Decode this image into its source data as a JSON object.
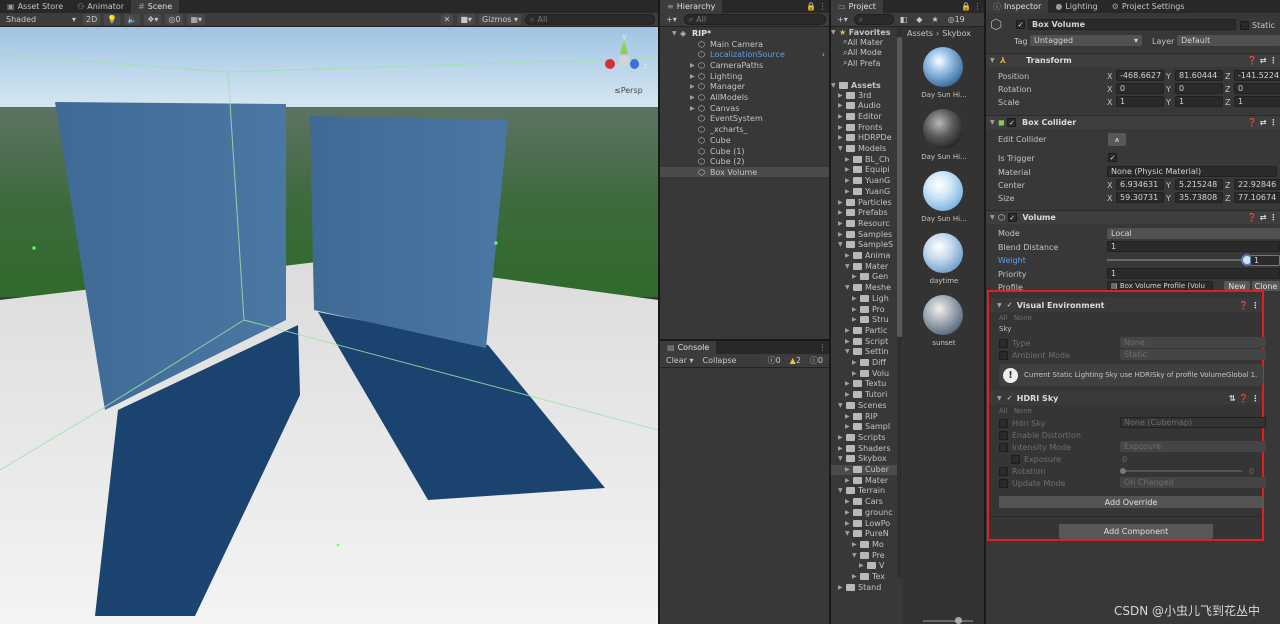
{
  "scene": {
    "tabs": [
      "Asset Store",
      "Animator",
      "Scene"
    ],
    "shading": "Shaded",
    "btn2d": "2D",
    "fx_count": "0",
    "gizmos": "Gizmos",
    "search_placeholder": "All",
    "persp": "Persp",
    "gizmo_axes": {
      "y": "y",
      "z": "z",
      "x": "x"
    }
  },
  "hierarchy": {
    "tab": "Hierarchy",
    "search_placeholder": "All",
    "root": "RIP*",
    "items": [
      {
        "label": "Main Camera",
        "arrow": "",
        "highlight": false
      },
      {
        "label": "LocalizationSource",
        "arrow": "",
        "highlight": true
      },
      {
        "label": "CameraPaths",
        "arrow": "▶",
        "highlight": false
      },
      {
        "label": "Lighting",
        "arrow": "▶",
        "highlight": false
      },
      {
        "label": "Manager",
        "arrow": "▶",
        "highlight": false
      },
      {
        "label": "AllModels",
        "arrow": "▶",
        "highlight": false
      },
      {
        "label": "Canvas",
        "arrow": "▶",
        "highlight": false
      },
      {
        "label": "EventSystem",
        "arrow": "",
        "highlight": false
      },
      {
        "label": "_xcharts_",
        "arrow": "",
        "highlight": false
      },
      {
        "label": "Cube",
        "arrow": "",
        "highlight": false
      },
      {
        "label": "Cube (1)",
        "arrow": "",
        "highlight": false
      },
      {
        "label": "Cube (2)",
        "arrow": "",
        "highlight": false
      },
      {
        "label": "Box Volume",
        "arrow": "",
        "highlight": false
      }
    ],
    "selected": "Box Volume"
  },
  "console": {
    "tab": "Console",
    "clear": "Clear",
    "collapse": "Collapse",
    "info": "0",
    "warn": "2",
    "err": "0"
  },
  "project": {
    "tab": "Project",
    "count": "19",
    "breadcrumb": [
      "Assets",
      "Skybox"
    ],
    "favorites": "Favorites",
    "fav_items": [
      "All Mater",
      "All Mode",
      "All Prefa"
    ],
    "assets": "Assets",
    "tree": [
      "3rd",
      "Audio",
      "Editor",
      "Fronts",
      "HDRPDe",
      "Models",
      "BL_Ch",
      "Equipi",
      "YuanG",
      "YuanG",
      "Particles",
      "Prefabs",
      "Resourc",
      "Samples",
      "SampleS",
      "Anima",
      "Mater",
      "Gen",
      "Meshe",
      "Ligh",
      "Pro",
      "Stru",
      "Partic",
      "Script",
      "Settin",
      "Diff",
      "Volu",
      "Textu",
      "Tutori",
      "Scenes",
      "RIP",
      "Sampl",
      "Scripts",
      "Shaders",
      "Skybox",
      "Cuber",
      "Mater",
      "Terrain",
      "Cars",
      "grounc",
      "LowPo",
      "PureN",
      "Mo",
      "Pre",
      "V",
      "Tex",
      "Stand"
    ],
    "thumbs": [
      "Day Sun Hi...",
      "Day Sun Hi...",
      "Day Sun Hi...",
      "daytime",
      "sunset"
    ]
  },
  "inspector": {
    "tabs": [
      "Inspector",
      "Lighting",
      "Project Settings"
    ],
    "name": "Box Volume",
    "static": "Static",
    "tag_label": "Tag",
    "tag": "Untagged",
    "layer_label": "Layer",
    "layer": "Default",
    "transform": {
      "title": "Transform",
      "position": {
        "label": "Position",
        "x": "-468.6627",
        "y": "81.60444",
        "z": "-141.5224"
      },
      "rotation": {
        "label": "Rotation",
        "x": "0",
        "y": "0",
        "z": "0"
      },
      "scale": {
        "label": "Scale",
        "x": "1",
        "y": "1",
        "z": "1"
      }
    },
    "collider": {
      "title": "Box Collider",
      "edit": "Edit Collider",
      "trigger": "Is Trigger",
      "material_label": "Material",
      "material": "None (Physic Material)",
      "center": {
        "label": "Center",
        "x": "6.934631",
        "y": "5.215248",
        "z": "22.92846"
      },
      "size": {
        "label": "Size",
        "x": "59.30731",
        "y": "35.73808",
        "z": "77.10674"
      }
    },
    "volume": {
      "title": "Volume",
      "mode_label": "Mode",
      "mode": "Local",
      "blend_label": "Blend Distance",
      "blend": "1",
      "weight_label": "Weight",
      "weight": "1",
      "weight_level": 1.0,
      "priority_label": "Priority",
      "priority": "1",
      "profile_label": "Profile",
      "profile": "Box Volume Profile (Volu",
      "new": "New",
      "clone": "Clone"
    },
    "visual_env": {
      "title": "Visual Environment",
      "all": "All",
      "none": "None",
      "sky": "Sky",
      "type_label": "Type",
      "type": "None",
      "ambient_label": "Ambient Mode",
      "ambient": "Static",
      "info": "Current Static Lighting Sky use HDRISky of profile VolumeGlobal 1."
    },
    "hdri": {
      "title": "HDRI Sky",
      "all": "All",
      "none": "None",
      "hdri_label": "Hdri Sky",
      "hdri": "None (Cubemap)",
      "distortion": "Enable Distortion",
      "intensity_label": "Intensity Mode",
      "intensity": "Exposure",
      "exposure_label": "Exposure",
      "exposure": "0",
      "rotation_label": "Rotation",
      "rotation": "0",
      "update_label": "Update Mode",
      "update": "On Changed"
    },
    "add_override": "Add Override",
    "add_component": "Add Component"
  },
  "watermark": "CSDN @小虫儿飞到花丛中",
  "colors": {
    "accent": "#4c7dc9",
    "highlight_text": "#5aa0e6",
    "red_box": "#e02020",
    "selection": "#2c5d87"
  }
}
